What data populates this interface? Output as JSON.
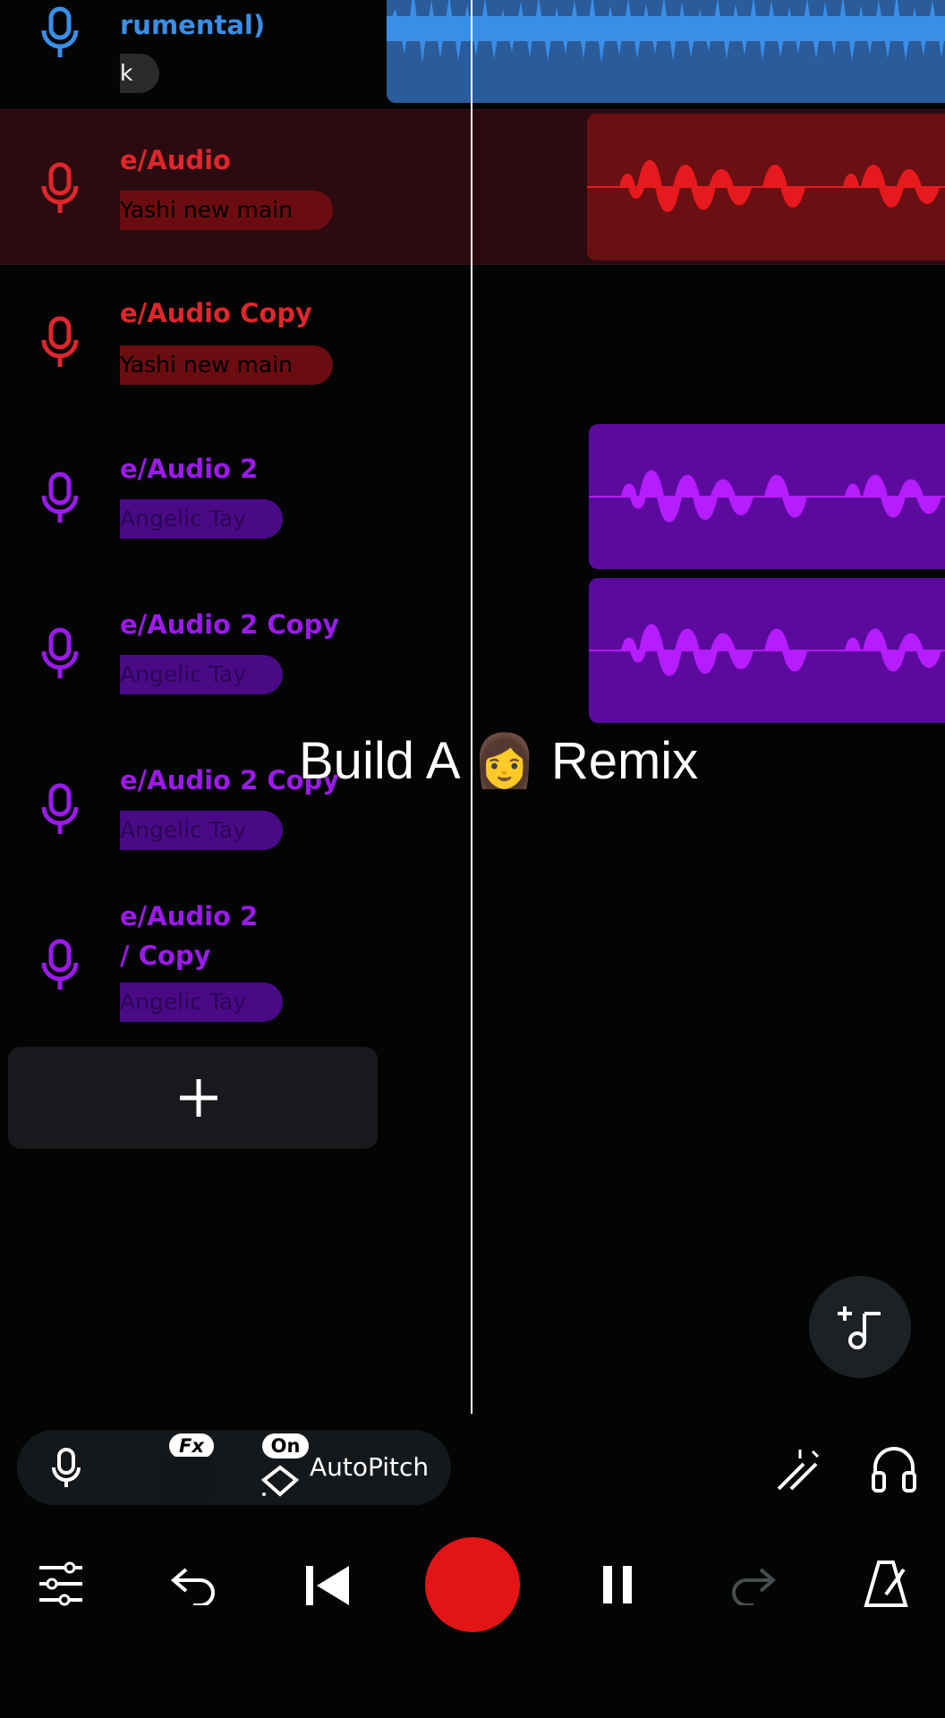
{
  "overlay": {
    "title": "Build A 👩 Remix"
  },
  "tracks": [
    {
      "name": "rumental)",
      "name2": "",
      "chip": "k",
      "color": "#3a8ee8",
      "pill_bg": "#2a2a2a",
      "pill_text": "#ffffff"
    },
    {
      "name": "e/Audio",
      "name2": "",
      "chip": "Yashi new main",
      "color": "#e0262c",
      "pill_bg": "#6b0d10",
      "pill_text": "#000000"
    },
    {
      "name": "e/Audio Copy",
      "name2": "",
      "chip": "Yashi new main",
      "color": "#e0262c",
      "pill_bg": "#6b0d10",
      "pill_text": "#000000"
    },
    {
      "name": "e/Audio 2",
      "name2": "",
      "chip": "Angelic Tay",
      "color": "#9b1aeb",
      "pill_bg": "#4a0a86",
      "pill_text": "#2c0555"
    },
    {
      "name": "e/Audio 2 Copy",
      "name2": "",
      "chip": "Angelic Tay",
      "color": "#9b1aeb",
      "pill_bg": "#4a0a86",
      "pill_text": "#2c0555"
    },
    {
      "name": "e/Audio 2 Copy",
      "name2": "",
      "chip": "Angelic Tay",
      "color": "#9b1aeb",
      "pill_bg": "#4a0a86",
      "pill_text": "#2c0555"
    },
    {
      "name": "e/Audio 2",
      "name2": "/ Copy",
      "chip": "Angelic Tay",
      "color": "#9b1aeb",
      "pill_bg": "#4a0a86",
      "pill_text": "#2c0555"
    }
  ],
  "colors": {
    "blue_clip": "#2a5b9a",
    "blue_wave": "#3a8ee8",
    "red_clip": "#6a0f12",
    "red_wave": "#e61a1e",
    "purple_clip": "#5c0a9e",
    "purple_wave": "#b51cff",
    "record": "#e31416"
  },
  "toolbar": {
    "fx_badge": "Fx",
    "on_badge": "On",
    "autopitch_label": "AutoPitch"
  },
  "icons": {
    "mic": "mic-icon",
    "plus": "plus-icon",
    "add_music": "add-music-icon",
    "wand": "magic-wand-icon",
    "headphones": "headphones-icon",
    "mixer": "mixer-sliders-icon",
    "undo": "undo-icon",
    "skip_back": "skip-back-icon",
    "record": "record-button",
    "pause": "pause-icon",
    "redo": "redo-icon",
    "metronome": "metronome-icon"
  }
}
